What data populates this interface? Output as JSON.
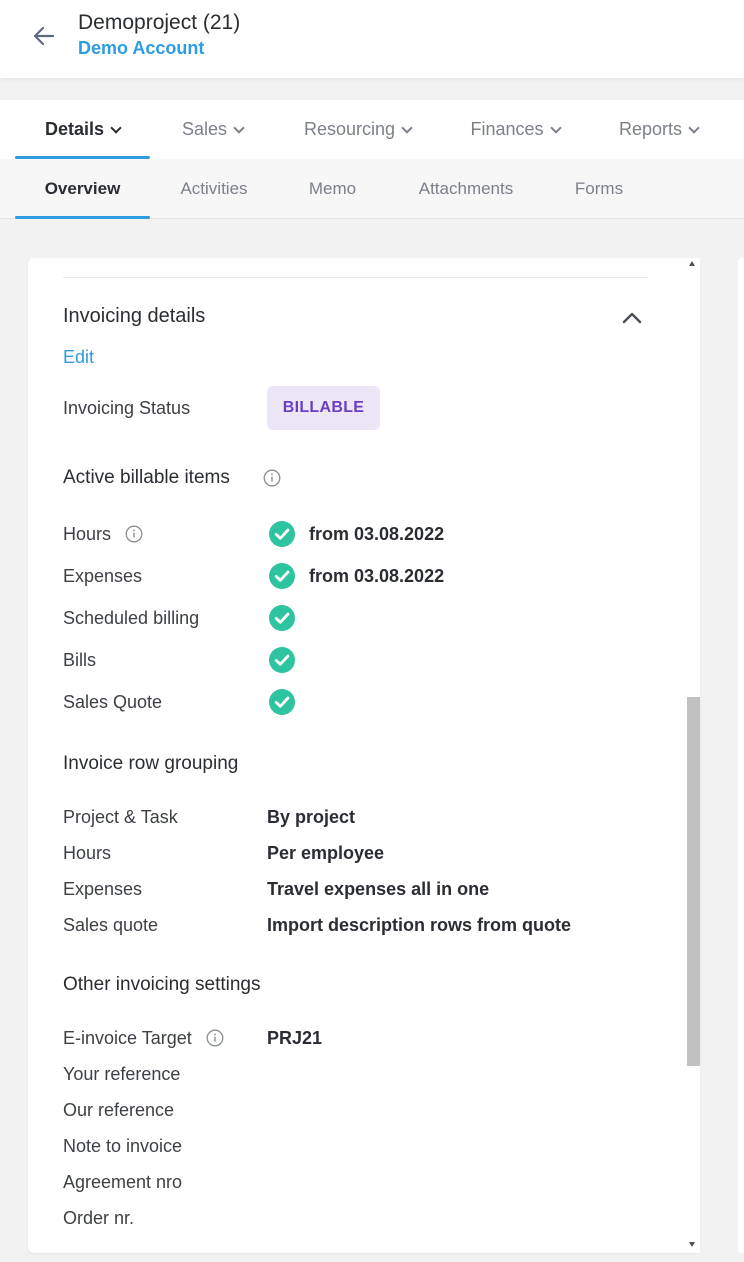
{
  "header": {
    "title": "Demoproject (21)",
    "account": "Demo Account"
  },
  "main_tabs": [
    {
      "label": "Details",
      "active": true
    },
    {
      "label": "Sales"
    },
    {
      "label": "Resourcing"
    },
    {
      "label": "Finances"
    },
    {
      "label": "Reports"
    }
  ],
  "sub_tabs": [
    {
      "label": "Overview",
      "active": true
    },
    {
      "label": "Activities"
    },
    {
      "label": "Memo"
    },
    {
      "label": "Attachments"
    },
    {
      "label": "Forms"
    }
  ],
  "invoicing": {
    "title": "Invoicing details",
    "edit_label": "Edit",
    "status_label": "Invoicing Status",
    "status_value": "BILLABLE",
    "active_items": {
      "title": "Active billable items",
      "rows": [
        {
          "label": "Hours",
          "value": "from 03.08.2022"
        },
        {
          "label": "Expenses",
          "value": "from 03.08.2022"
        },
        {
          "label": "Scheduled billing",
          "value": ""
        },
        {
          "label": "Bills",
          "value": ""
        },
        {
          "label": "Sales Quote",
          "value": ""
        }
      ]
    },
    "grouping": {
      "title": "Invoice row grouping",
      "rows": [
        {
          "label": "Project & Task",
          "value": "By project"
        },
        {
          "label": "Hours",
          "value": "Per employee"
        },
        {
          "label": "Expenses",
          "value": "Travel expenses all in one"
        },
        {
          "label": "Sales quote",
          "value": "Import description rows from quote"
        }
      ]
    },
    "other": {
      "title": "Other invoicing settings",
      "rows": [
        {
          "label": "E-invoice Target",
          "value": "PRJ21"
        },
        {
          "label": "Your reference",
          "value": ""
        },
        {
          "label": "Our reference",
          "value": ""
        },
        {
          "label": "Note to invoice",
          "value": ""
        },
        {
          "label": "Agreement nro",
          "value": ""
        },
        {
          "label": "Order nr.",
          "value": ""
        }
      ]
    }
  },
  "colors": {
    "accent": "#2d9ce0",
    "check_green": "#2ec4a0",
    "badge_bg": "#ece6f7",
    "badge_text": "#6a3ec0"
  },
  "icons": [
    "back-arrow-icon",
    "chevron-down-icon",
    "chevron-up-icon",
    "info-icon",
    "check-circle-icon"
  ]
}
